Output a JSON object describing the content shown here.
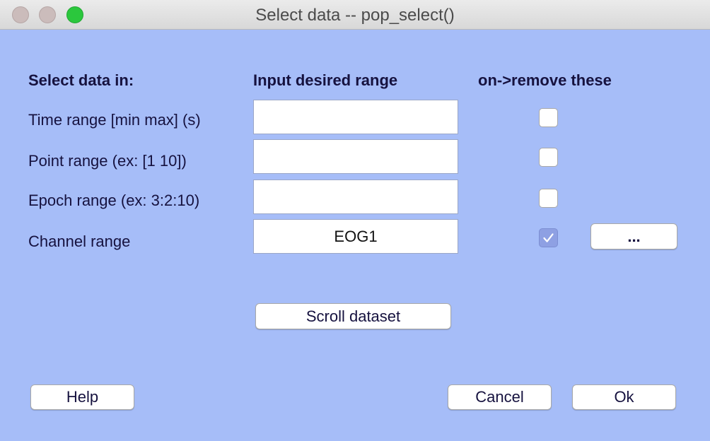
{
  "window": {
    "title": "Select data -- pop_select()"
  },
  "headers": {
    "select_data_in": "Select data in:",
    "input_desired_range": "Input desired range",
    "remove_these": "on->remove these"
  },
  "rows": [
    {
      "label": "Time range [min max] (s)",
      "value": "",
      "remove_checked": false
    },
    {
      "label": "Point range (ex: [1 10])",
      "value": "",
      "remove_checked": false
    },
    {
      "label": "Epoch range (ex: 3:2:10)",
      "value": "",
      "remove_checked": false
    },
    {
      "label": "Channel range",
      "value": "EOG1",
      "remove_checked": true
    }
  ],
  "buttons": {
    "channel_browse": "...",
    "scroll_dataset": "Scroll dataset",
    "help": "Help",
    "cancel": "Cancel",
    "ok": "Ok"
  },
  "colors": {
    "background": "#a6bdf8",
    "text": "#16123f",
    "checkbox_checked": "#8ea0e3"
  }
}
